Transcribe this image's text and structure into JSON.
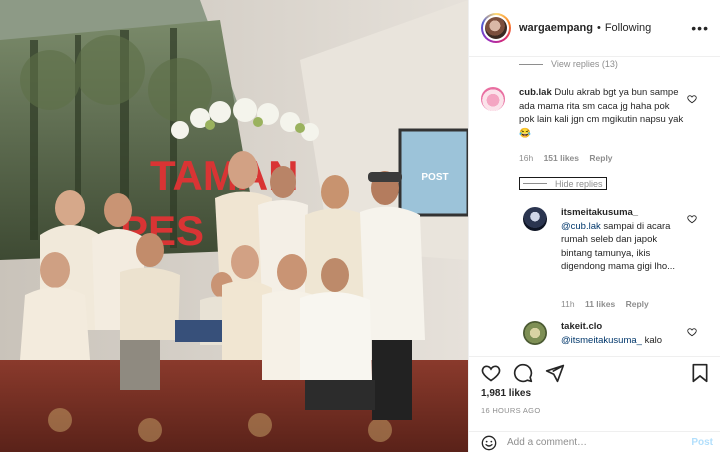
{
  "post": {
    "username": "wargaempang",
    "separator": "•",
    "follow_status": "Following",
    "photo_sign_text": "TAMAN",
    "photo_sign_text_2": "PES",
    "photo_tv_text": "POST"
  },
  "comments": {
    "view_replies": "View replies (13)",
    "comment1": {
      "username": "cub.lak",
      "text": "Dulu akrab bgt ya bun sampe ada mama rita sm caca jg haha pok pok lain kali jgn cm mgikutin napsu yak 😂",
      "time": "16h",
      "likes": "151 likes",
      "reply": "Reply"
    },
    "hide_replies": "Hide replies",
    "reply1": {
      "username": "itsmeitakusuma_",
      "mention": "@cub.lak",
      "text": "sampai di acara rumah seleb dan japok bintang tamunya, ikis digendong mama gigi lho...",
      "time": "11h",
      "likes": "11 likes",
      "reply": "Reply"
    },
    "reply2": {
      "username": "takeit.clo",
      "mention": "@itsmeitakusuma_",
      "text": "kalo"
    }
  },
  "actions": {
    "likes": "1,981 likes",
    "time_ago": "16 HOURS AGO",
    "comment_placeholder": "Add a comment…",
    "post_label": "Post",
    "icons": [
      "heart-icon",
      "comment-icon",
      "share-icon",
      "bookmark-icon",
      "emoji-icon"
    ],
    "post_button_color": "#b2dffc"
  }
}
